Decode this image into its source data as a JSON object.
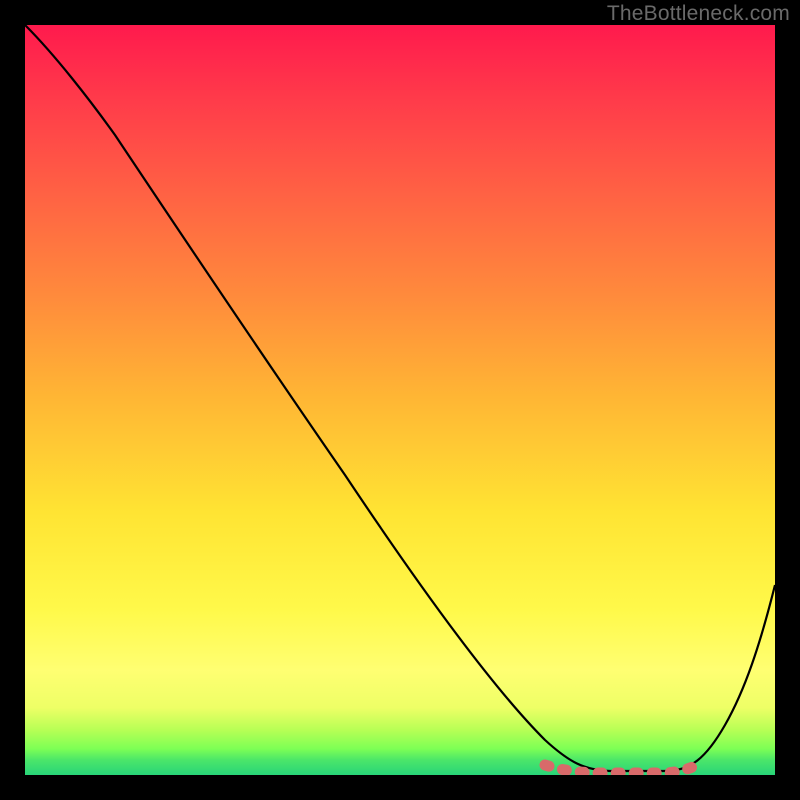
{
  "watermark": "TheBottleneck.com",
  "chart_data": {
    "type": "line",
    "title": "",
    "xlabel": "",
    "ylabel": "",
    "xlim": [
      0,
      100
    ],
    "ylim": [
      0,
      100
    ],
    "x": [
      0,
      5,
      12,
      20,
      28,
      36,
      44,
      52,
      60,
      66,
      70,
      74,
      78,
      82,
      86,
      90,
      93,
      96,
      100
    ],
    "values": [
      100,
      96,
      89,
      79,
      68,
      57,
      46,
      35,
      24,
      15,
      9,
      4,
      1.5,
      0.5,
      0.5,
      1.5,
      5,
      12,
      27
    ],
    "marker_segment": {
      "x_start": 70,
      "x_end": 90,
      "y_level": 0.5,
      "style": "thick-dotted",
      "color": "#d86a6a"
    },
    "background_gradient": {
      "top": "#ff1a4d",
      "mid": "#ffe433",
      "bottom": "#28d478"
    }
  }
}
